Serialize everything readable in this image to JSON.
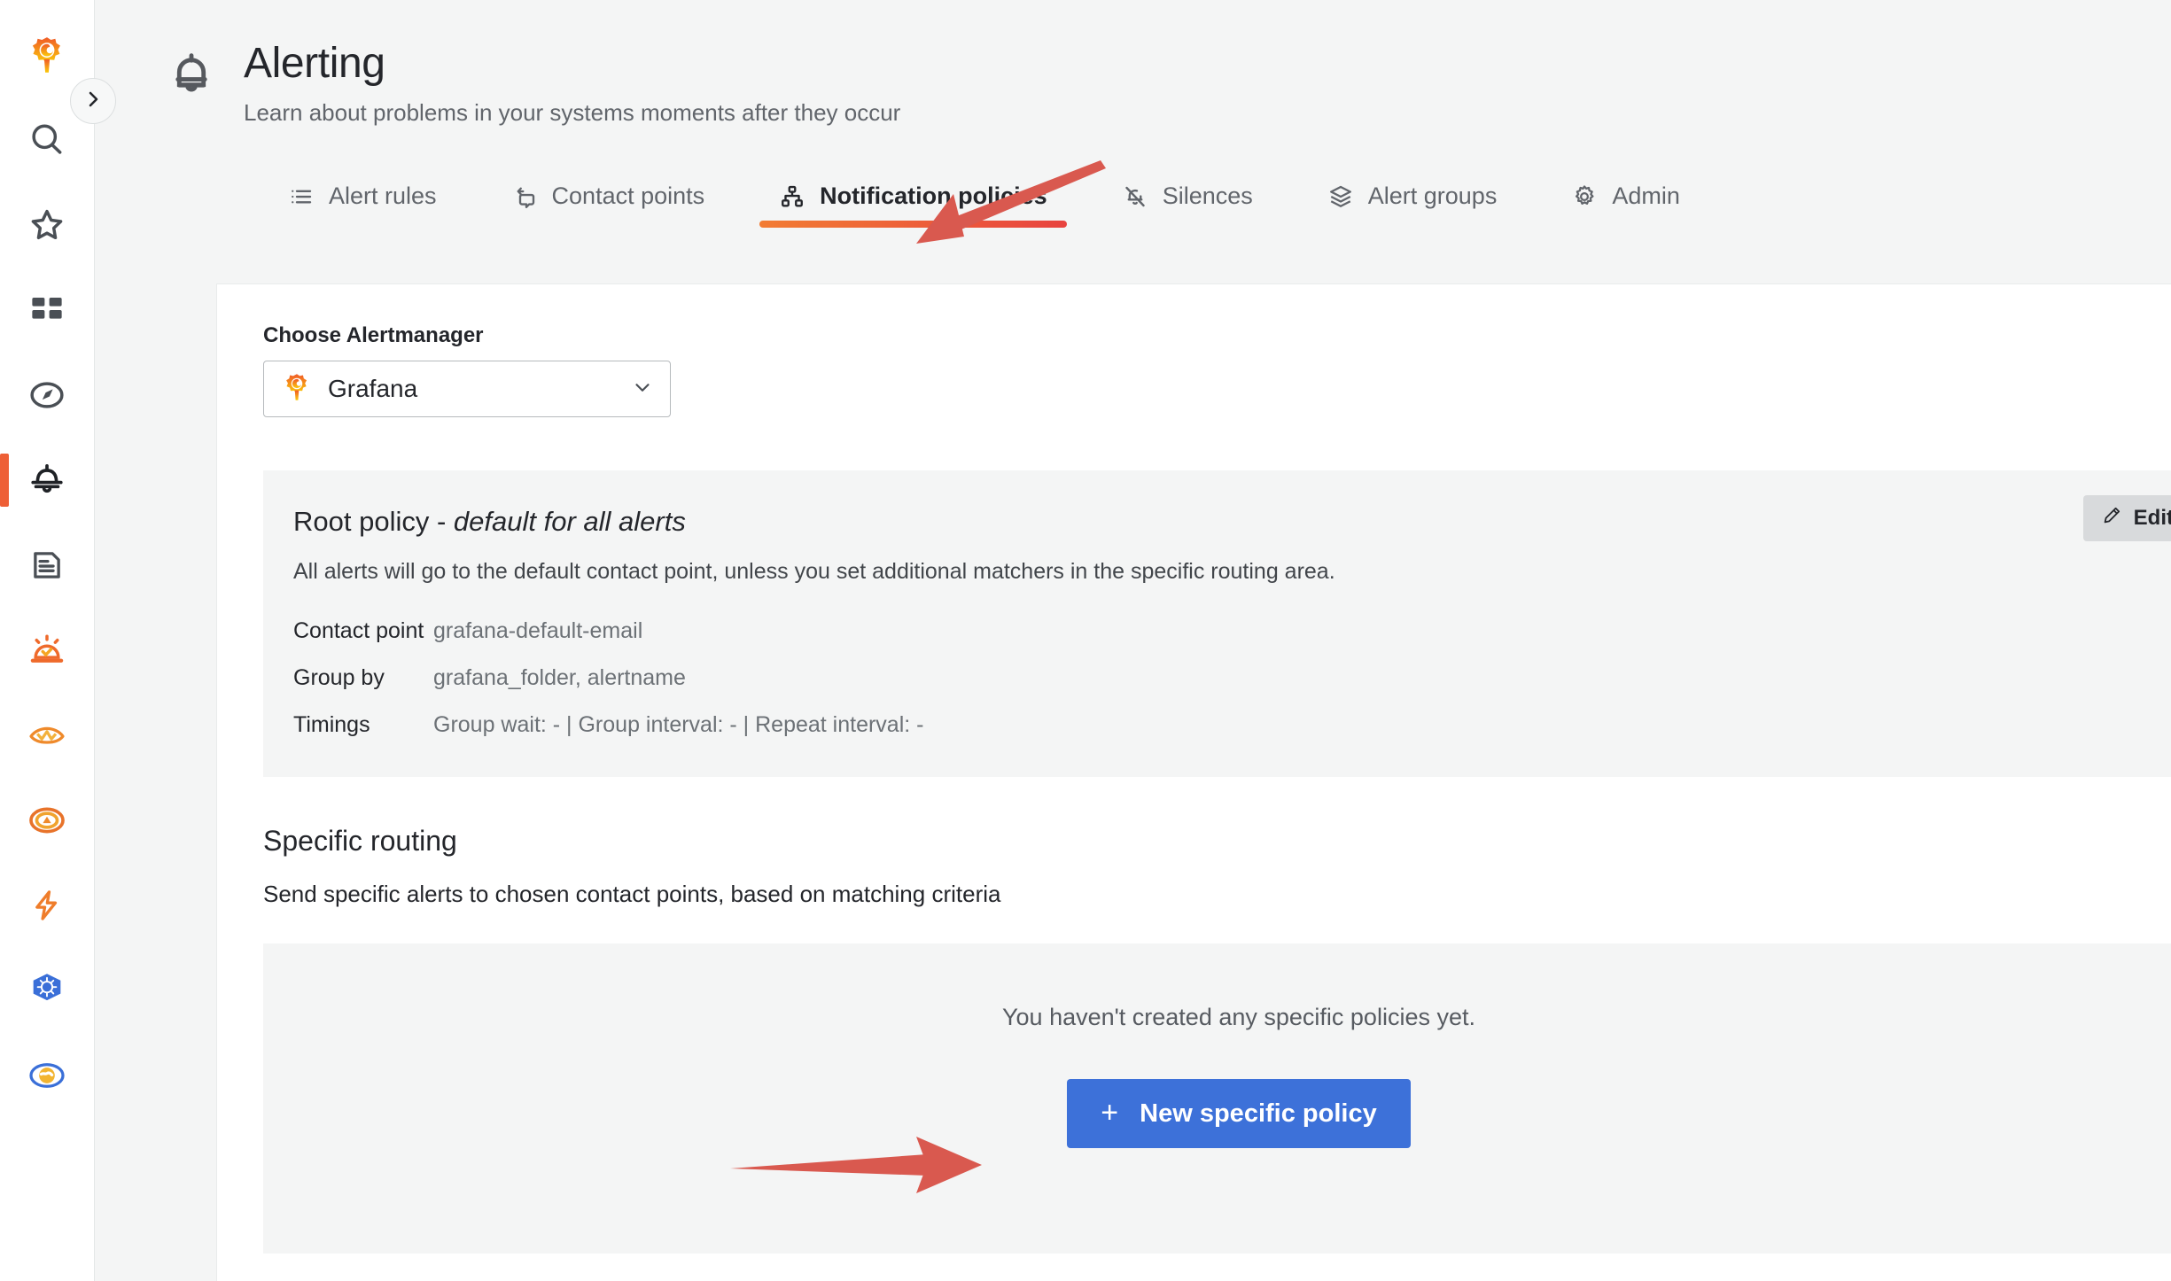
{
  "sidebar": {
    "toggle": {
      "name": "expand-sidebar",
      "icon": "chevron-right-icon"
    },
    "items": [
      {
        "name": "grafana-logo",
        "icon": "grafana-logo-icon",
        "active": false
      },
      {
        "name": "search",
        "icon": "search-icon",
        "active": false
      },
      {
        "name": "starred",
        "icon": "star-icon",
        "active": false
      },
      {
        "name": "dashboards",
        "icon": "dashboards-icon",
        "active": false
      },
      {
        "name": "explore",
        "icon": "compass-icon",
        "active": false
      },
      {
        "name": "alerting",
        "icon": "bell-icon",
        "active": true
      },
      {
        "name": "reports",
        "icon": "document-icon",
        "active": false
      },
      {
        "name": "incident",
        "icon": "siren-icon",
        "active": false
      },
      {
        "name": "machine-learning",
        "icon": "ml-icon",
        "active": false
      },
      {
        "name": "oncall",
        "icon": "oncall-icon",
        "active": false
      },
      {
        "name": "synthetic-monitoring",
        "icon": "bolt-icon",
        "active": false
      },
      {
        "name": "kubernetes",
        "icon": "kubernetes-icon",
        "active": false
      },
      {
        "name": "application-observability",
        "icon": "globe-icon",
        "active": false
      }
    ]
  },
  "header": {
    "icon": "bell-icon",
    "title": "Alerting",
    "subtitle": "Learn about problems in your systems moments after they occur"
  },
  "tabs": [
    {
      "label": "Alert rules",
      "icon": "list-icon",
      "active": false
    },
    {
      "label": "Contact points",
      "icon": "comment-share-icon",
      "active": false
    },
    {
      "label": "Notification policies",
      "icon": "sitemap-icon",
      "active": true
    },
    {
      "label": "Silences",
      "icon": "bell-slash-icon",
      "active": false
    },
    {
      "label": "Alert groups",
      "icon": "layers-icon",
      "active": false
    },
    {
      "label": "Admin",
      "icon": "gear-icon",
      "active": false
    }
  ],
  "alertmanager": {
    "label": "Choose Alertmanager",
    "selected": "Grafana",
    "icon": "grafana-logo-icon",
    "chevron": "chevron-down-icon"
  },
  "root_policy": {
    "title_prefix": "Root policy - ",
    "title_emphasis": "default for all alerts",
    "description": "All alerts will go to the default contact point, unless you set additional matchers in the specific routing area.",
    "edit_label": "Edit",
    "edit_icon": "pencil-icon",
    "rows": [
      {
        "key": "Contact point",
        "value": "grafana-default-email"
      },
      {
        "key": "Group by",
        "value": "grafana_folder, alertname"
      },
      {
        "key": "Timings",
        "value": "Group wait: - | Group interval: - | Repeat interval: -"
      }
    ]
  },
  "specific_routing": {
    "title": "Specific routing",
    "description": "Send specific alerts to chosen contact points, based on matching criteria",
    "empty_text": "You haven't created any specific policies yet.",
    "new_policy_label": "New specific policy",
    "new_policy_plus": "+"
  },
  "annotations": [
    {
      "name": "arrow-to-notification-policies-tab",
      "color": "#d9594f",
      "direction": "down-left"
    },
    {
      "name": "arrow-to-new-specific-policy-button",
      "color": "#d9594f",
      "direction": "right"
    }
  ],
  "colors": {
    "accent_orange": "#ee5f36",
    "tab_gradient_start": "#f27c33",
    "tab_gradient_end": "#e8433f",
    "primary_blue": "#3d71d9",
    "annotation_red": "#d9594f",
    "page_bg": "#f4f5f5",
    "panel_bg": "#ffffff"
  }
}
